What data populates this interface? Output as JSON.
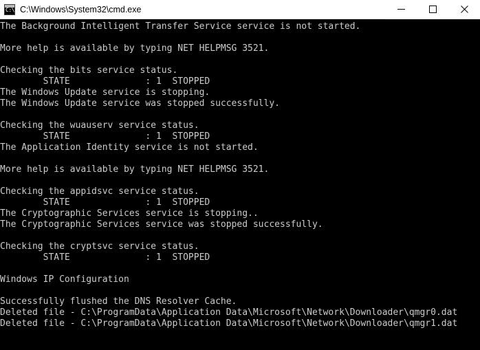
{
  "window": {
    "title": "C:\\Windows\\System32\\cmd.exe",
    "icon": "cmd-console-icon",
    "icon_prompt_text": "C:\\",
    "titlebar_bg": "#ffffff",
    "titlebar_fg": "#000000",
    "console_bg": "#000000",
    "console_fg": "#cccccc",
    "controls": {
      "minimize_label": "Minimize",
      "maximize_label": "Maximize",
      "close_label": "Close"
    }
  },
  "console": {
    "lines": [
      "The Background Intelligent Transfer Service service is not started.",
      "",
      "More help is available by typing NET HELPMSG 3521.",
      "",
      "Checking the bits service status.",
      "        STATE              : 1  STOPPED",
      "The Windows Update service is stopping.",
      "The Windows Update service was stopped successfully.",
      "",
      "Checking the wuauserv service status.",
      "        STATE              : 1  STOPPED",
      "The Application Identity service is not started.",
      "",
      "More help is available by typing NET HELPMSG 3521.",
      "",
      "Checking the appidsvc service status.",
      "        STATE              : 1  STOPPED",
      "The Cryptographic Services service is stopping..",
      "The Cryptographic Services service was stopped successfully.",
      "",
      "Checking the cryptsvc service status.",
      "        STATE              : 1  STOPPED",
      "",
      "Windows IP Configuration",
      "",
      "Successfully flushed the DNS Resolver Cache.",
      "Deleted file - C:\\ProgramData\\Application Data\\Microsoft\\Network\\Downloader\\qmgr0.dat",
      "Deleted file - C:\\ProgramData\\Application Data\\Microsoft\\Network\\Downloader\\qmgr1.dat"
    ]
  }
}
